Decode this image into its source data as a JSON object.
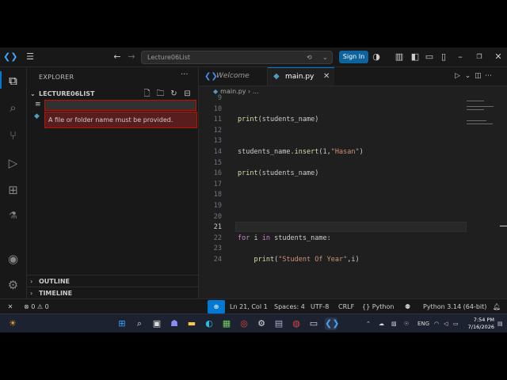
{
  "titlebar": {
    "search_text": "Lecture06List",
    "signin_label": "Sign In"
  },
  "sidebar": {
    "title": "EXPLORER",
    "more": "···",
    "folder_name": "LECTURE06LIST",
    "error_message": "A file or folder name must be provided.",
    "outline_label": "OUTLINE",
    "timeline_label": "TIMELINE"
  },
  "editor": {
    "tabs": [
      {
        "label": "Welcome"
      },
      {
        "label": "main.py"
      }
    ],
    "breadcrumb_file": "main.py",
    "breadcrumb_more": "…",
    "lines": [
      {
        "n": "9",
        "code": ""
      },
      {
        "n": "10",
        "code": ""
      },
      {
        "n": "11",
        "code": "print(students_name)"
      },
      {
        "n": "12",
        "code": ""
      },
      {
        "n": "13",
        "code": ""
      },
      {
        "n": "14",
        "code": "students_name.insert(1,\"Hasan\")"
      },
      {
        "n": "15",
        "code": ""
      },
      {
        "n": "16",
        "code": "print(students_name)"
      },
      {
        "n": "17",
        "code": ""
      },
      {
        "n": "18",
        "code": ""
      },
      {
        "n": "19",
        "code": ""
      },
      {
        "n": "20",
        "code": ""
      },
      {
        "n": "21",
        "code": ""
      },
      {
        "n": "22",
        "code": "for i in students_name:"
      },
      {
        "n": "23",
        "code": ""
      },
      {
        "n": "24",
        "code": "    print(\"Student Of Year\",i)"
      }
    ]
  },
  "statusbar": {
    "errors": "0",
    "warnings": "0",
    "position": "Ln 21, Col 1",
    "spaces": "Spaces: 4",
    "encoding": "UTF-8",
    "eol": "CRLF",
    "language": "Python",
    "interpreter": "Python 3.14 (64-bit)"
  },
  "taskbar": {
    "lang": "ENG",
    "time": "7:54 PM",
    "date": "7/16/2026"
  }
}
